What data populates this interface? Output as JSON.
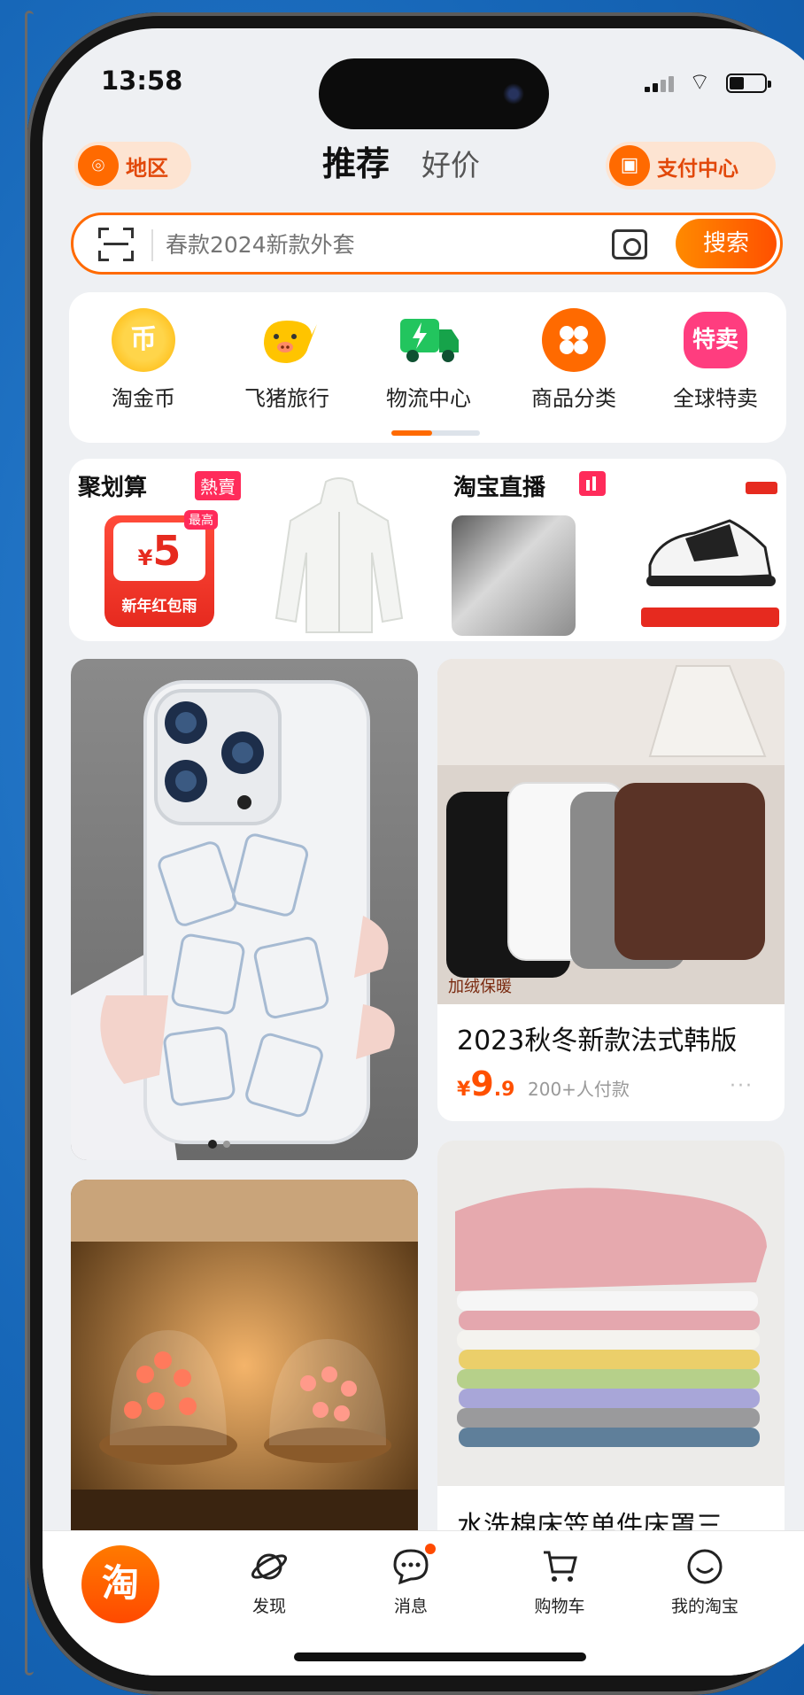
{
  "status": {
    "time": "13:58"
  },
  "header": {
    "region_label": "地区",
    "tabs": [
      {
        "label": "推荐"
      },
      {
        "label": "好价"
      }
    ],
    "pay_label": "支付中心"
  },
  "search": {
    "placeholder": "春款2024新款外套",
    "button_label": "搜索"
  },
  "shortcuts": [
    {
      "label": "淘金币",
      "icon": "coin-icon",
      "glyph": "币",
      "color": "#ffb300"
    },
    {
      "label": "飞猪旅行",
      "icon": "pig-icon",
      "glyph": "",
      "color": "#ffc400"
    },
    {
      "label": "物流中心",
      "icon": "truck-icon",
      "glyph": "⚡",
      "color": "#22c55e"
    },
    {
      "label": "商品分类",
      "icon": "category-icon",
      "glyph": "✤",
      "color": "#ff6a00"
    },
    {
      "label": "全球特卖",
      "icon": "sale-icon",
      "glyph": "特卖",
      "color": "#ff3d7f"
    }
  ],
  "promo": {
    "juhuasuan": {
      "title": "聚划算",
      "tag": "熱賣",
      "redpack_currency": "¥",
      "redpack_amount": "5",
      "redpack_badge": "最高",
      "redpack_label": "新年红包雨"
    },
    "live": {
      "title": "淘宝直播"
    }
  },
  "feed": [
    {
      "id": "phone-case",
      "title": "",
      "image": "phone-case-image"
    },
    {
      "id": "vest",
      "image_caption": "加绒保暖",
      "title": "2023秋冬新款法式韩版",
      "price_currency": "¥",
      "price_int": "9",
      "price_dec": ".9",
      "sold": "200+人付款",
      "more": "···"
    },
    {
      "id": "tulip-lamp",
      "title": "",
      "image": "tulip-lamp-image"
    },
    {
      "id": "bedsheet",
      "title": "水洗棉床笠单件床罩三"
    }
  ],
  "tabbar": [
    {
      "label": "淘",
      "icon": "taobao-home-icon"
    },
    {
      "label": "发现",
      "icon": "planet-icon"
    },
    {
      "label": "消息",
      "icon": "message-icon"
    },
    {
      "label": "购物车",
      "icon": "cart-icon"
    },
    {
      "label": "我的淘宝",
      "icon": "smile-icon"
    }
  ],
  "colors": {
    "accent": "#ff6a00",
    "background": "#1767b8",
    "price": "#ff5000"
  }
}
